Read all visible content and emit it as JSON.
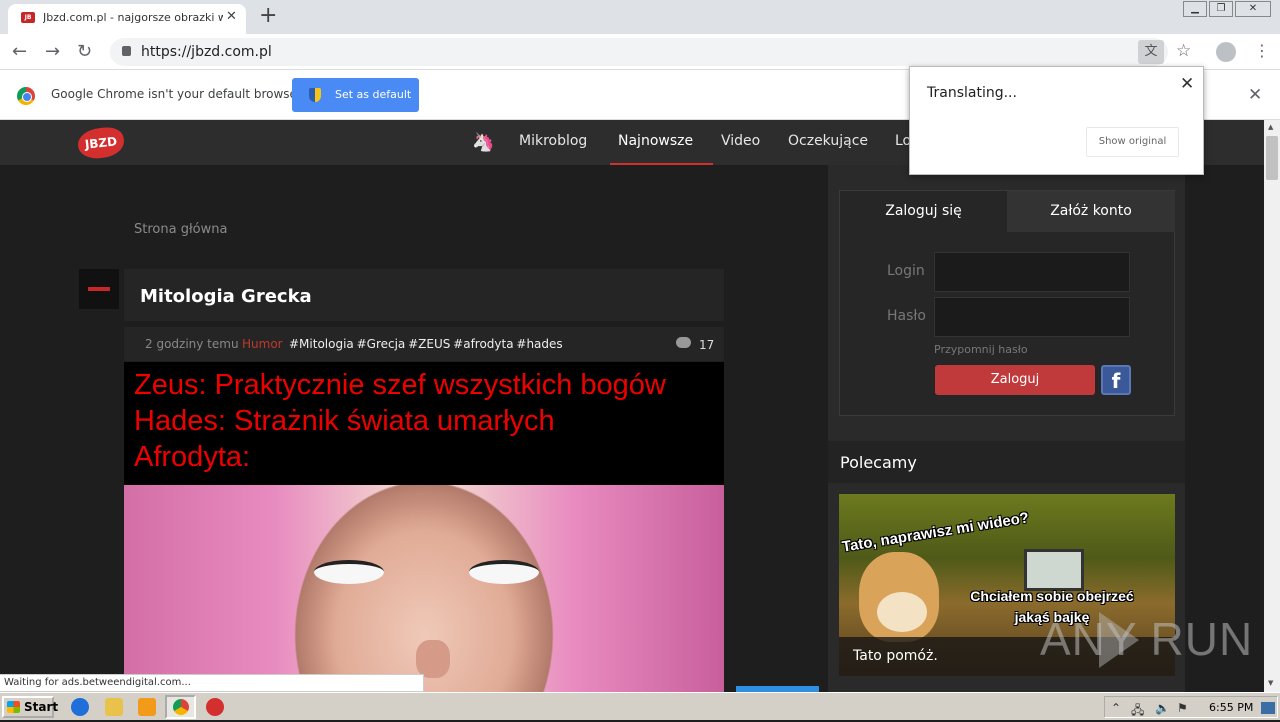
{
  "browser": {
    "tab_title": "Jbzd.com.pl - najgorsze obrazki w internecie",
    "url": "https://jbzd.com.pl",
    "infobar_message": "Google Chrome isn't your default browser",
    "set_default_label": "Set as default"
  },
  "translate_popup": {
    "title": "Translating...",
    "show_original_label": "Show original"
  },
  "site": {
    "logo_text": "JBZD",
    "nav": [
      "Mikroblog",
      "Najnowsze",
      "Video",
      "Oczekujące",
      "Lo"
    ],
    "active_nav": "Najnowsze"
  },
  "breadcrumb": "Strona główna",
  "post": {
    "title": "Mitologia Grecka",
    "time": "2 godziny temu",
    "category": "Humor",
    "tags": "#Mitologia #Grecja #ZEUS #afrodyta #hades",
    "comments": "17",
    "caption_lines": [
      "Zeus: Praktycznie szef wszystkich bogów",
      "Hades: Strażnik świata umarłych",
      "Afrodyta:"
    ]
  },
  "sidebar": {
    "tab_login": "Zaloguj się",
    "tab_register": "Załóż konto",
    "login_label": "Login",
    "password_label": "Hasło",
    "remind_password": "Przypomnij hasło",
    "login_button": "Zaloguj",
    "recommended_title": "Polecamy",
    "recommended_card": {
      "meme_top": "Tato, naprawisz mi wideo?",
      "meme_middle": "Chciałem sobie obejrzeć jakąś bajkę",
      "caption": "Tato pomóż."
    }
  },
  "status_text": "Waiting for ads.betweendigital.com...",
  "watermark": "ANY RUN",
  "taskbar": {
    "start_label": "Start",
    "clock": "6:55 PM"
  },
  "colors": {
    "accent_red": "#d32f2f",
    "caption_red": "#ee0000",
    "chrome_blue": "#4a8af4",
    "facebook_blue": "#3b5998"
  }
}
